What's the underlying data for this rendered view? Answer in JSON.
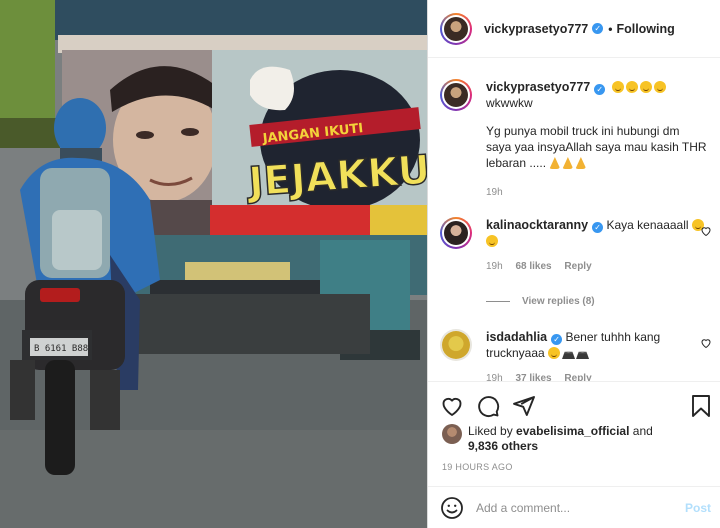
{
  "post": {
    "author": "vickyprasetyo777",
    "follow_state": "Following",
    "caption_line1": "wkwwkw",
    "caption_line2": "Yg punya mobil truck ini hubungi dm saya yaa insyaAllah saya mau kasih THR lebaran .....",
    "caption_time": "19h",
    "photo_overlay_text": {
      "sign_top": "JANGAN IKUTI",
      "sign_big": "JEJAKKU",
      "plate": "B 6161 B88"
    }
  },
  "comments": [
    {
      "user": "kalinaocktaranny",
      "verified": true,
      "text": "Kaya kenaaaall",
      "time": "19h",
      "likes": "68 likes",
      "reply": "Reply",
      "view_replies": "View replies (8)"
    },
    {
      "user": "isdadahlia",
      "verified": false,
      "text": "Bener tuhhh kang trucknyaaa",
      "time": "19h",
      "likes": "37 likes",
      "reply": "Reply"
    }
  ],
  "actions": {
    "liked_by_prefix": "Liked by",
    "liked_by_user": "evabelisima_official",
    "liked_by_and": "and",
    "others": "9,836 others",
    "timestamp": "19 HOURS AGO"
  },
  "composer": {
    "placeholder": "Add a comment...",
    "post_label": "Post"
  },
  "colors": {
    "link_blue": "#3897f0",
    "post_disabled": "#b2dffc",
    "secondary_text": "#8e8e8e"
  },
  "icons": [
    "heart-icon",
    "comment-icon",
    "share-icon",
    "bookmark-icon",
    "verified-badge-icon",
    "smiley-icon",
    "emoji-icon"
  ]
}
